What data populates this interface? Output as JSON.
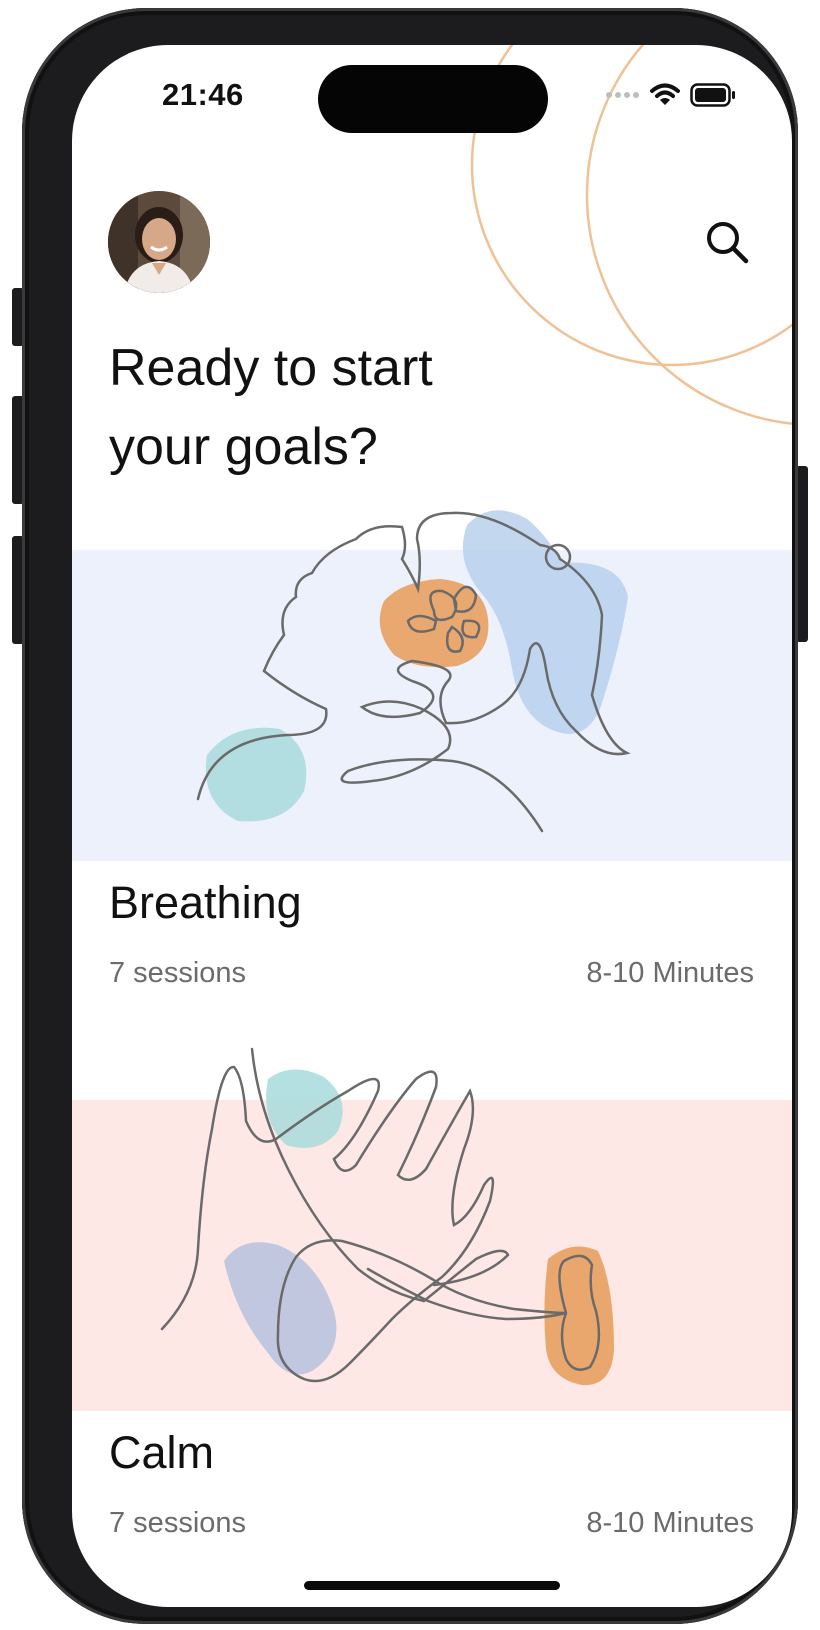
{
  "status_bar": {
    "time": "21:46"
  },
  "header": {
    "avatar_icon": "user-avatar-photo",
    "search_icon": "search-icon",
    "title_line1": "Ready to start",
    "title_line2": "your goals?"
  },
  "colors": {
    "ring_stroke": "#efc195",
    "breathing_band": "#ecf1fc",
    "calm_band": "#fde8e6",
    "blob_blue": "#b9d0ec",
    "blob_orange": "#e8a05f",
    "blob_teal": "#a8dadc",
    "blob_lavender": "#b6c1dc",
    "line_art": "#6a6a6a",
    "text_primary": "#111111",
    "text_secondary": "#6b6b6b"
  },
  "cards": [
    {
      "title": "Breathing",
      "sessions": "7 sessions",
      "duration": "8-10 Minutes",
      "illustration": "woman-profile-line-art"
    },
    {
      "title": "Calm",
      "sessions": "7 sessions",
      "duration": "8-10 Minutes",
      "illustration": "hand-flower-line-art"
    }
  ]
}
